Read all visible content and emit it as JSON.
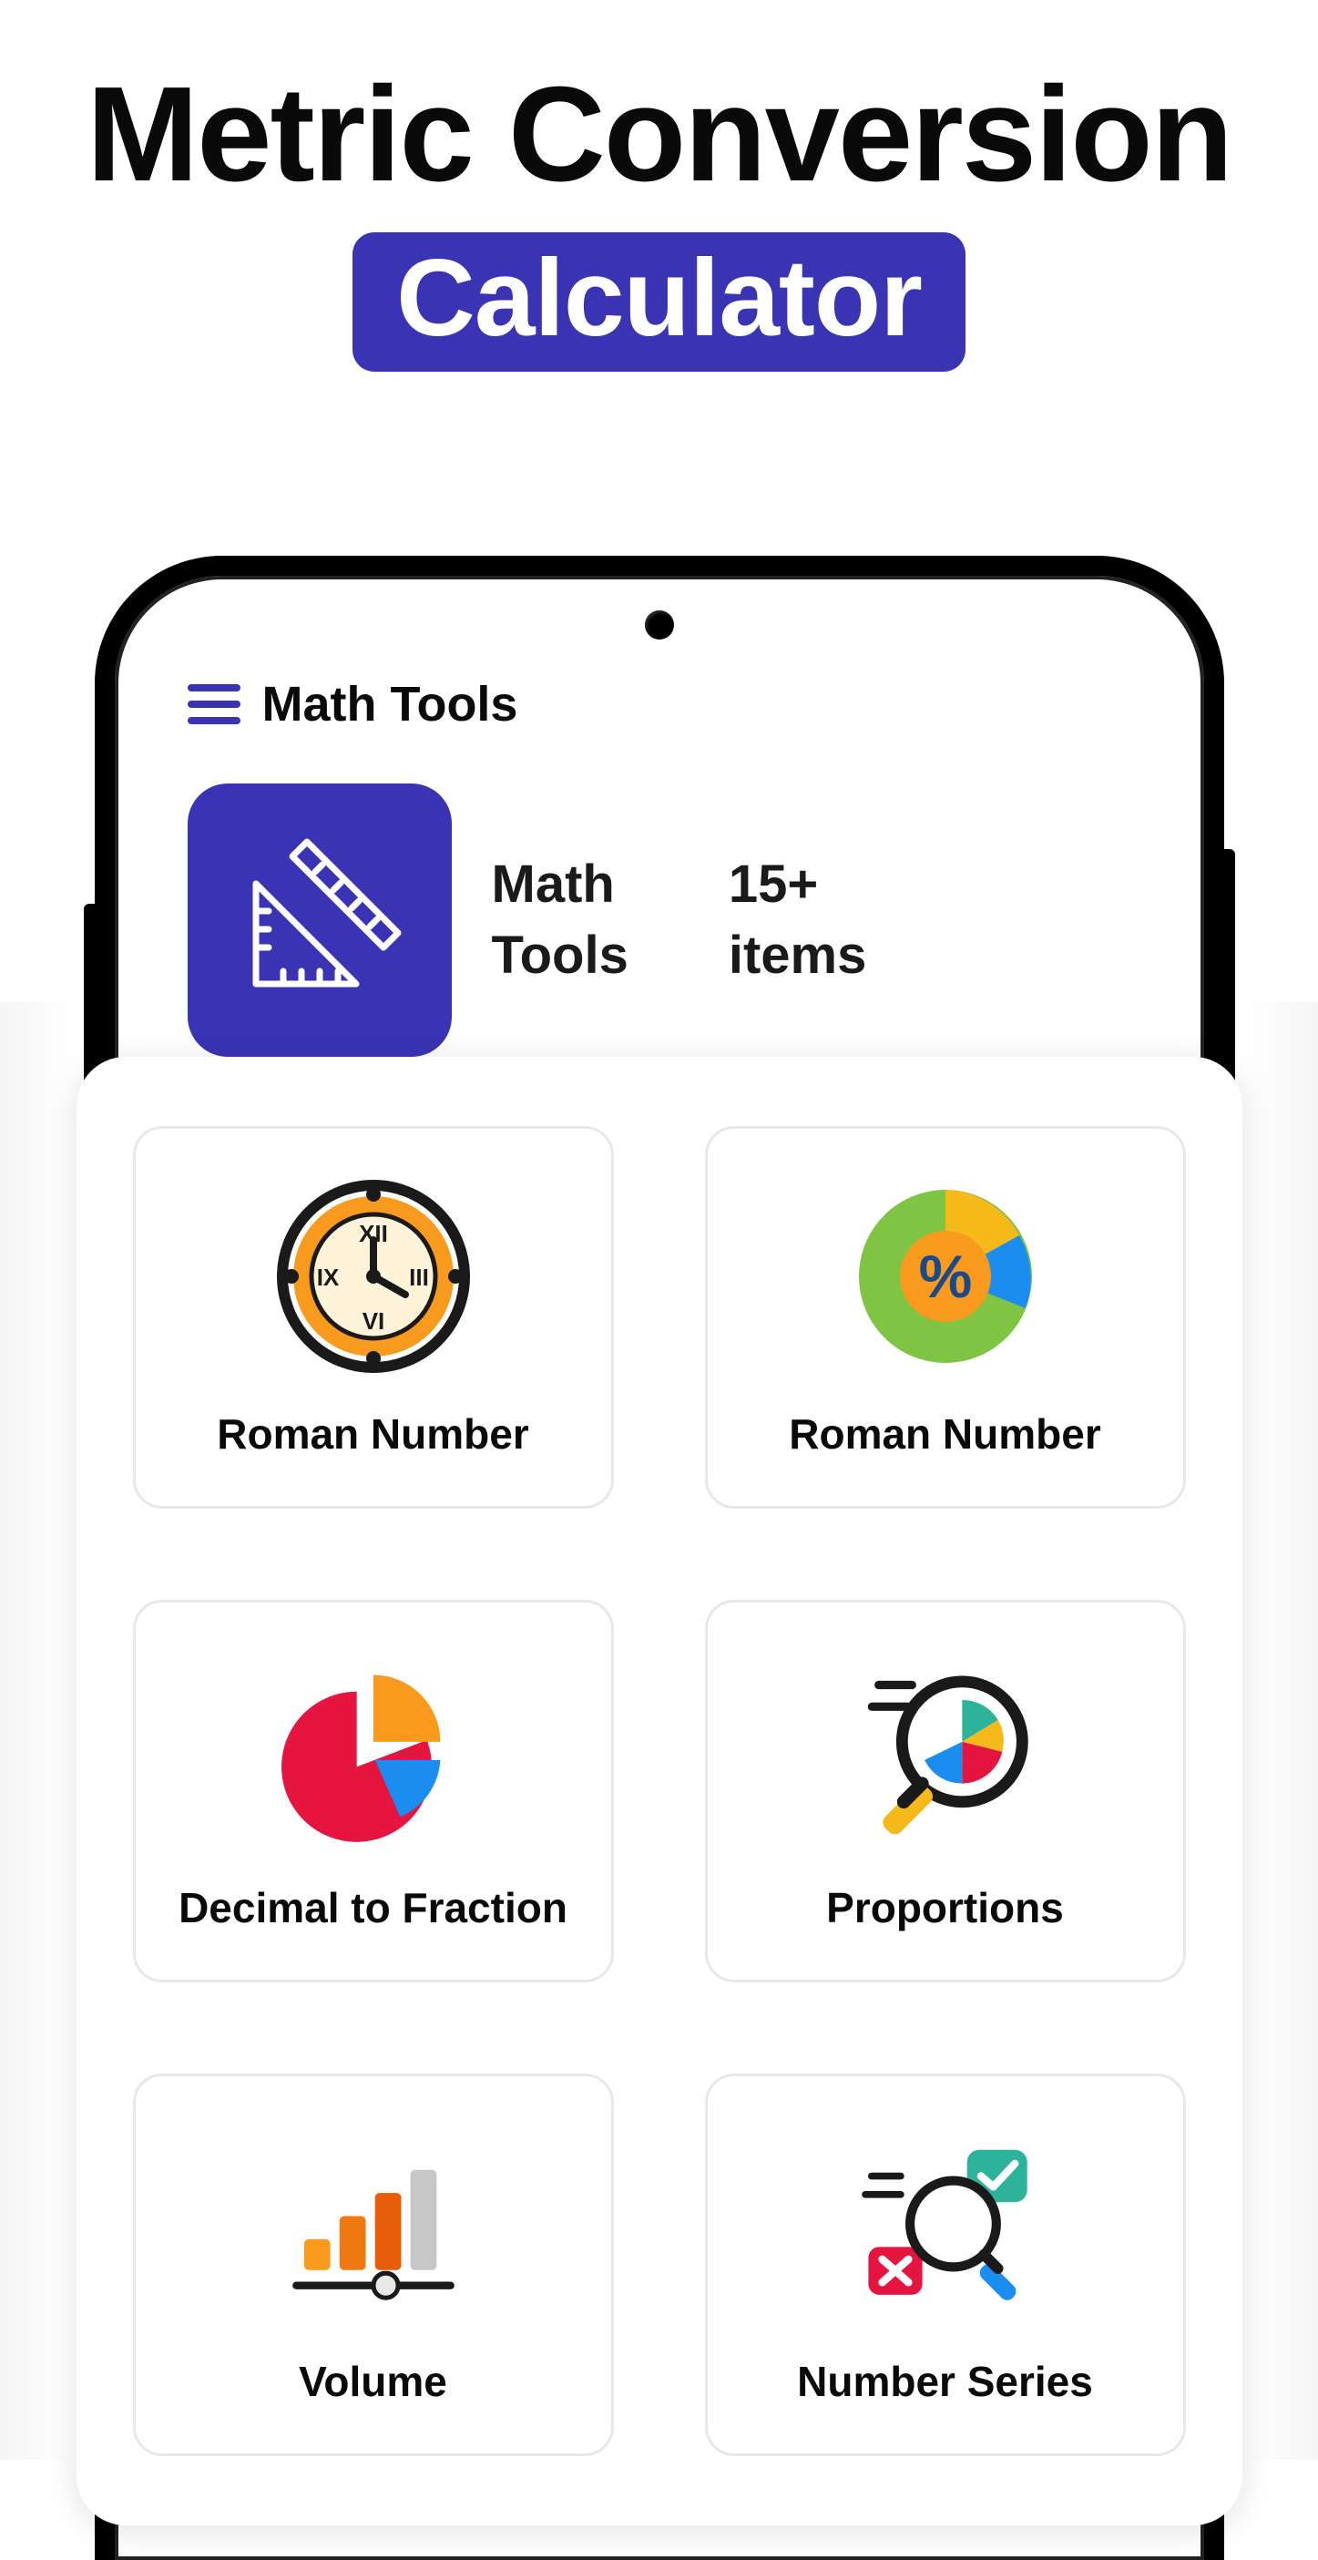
{
  "hero": {
    "title": "Metric Conversion",
    "badge": "Calculator"
  },
  "app": {
    "header_title": "Math Tools",
    "section": {
      "name_line1": "Math",
      "name_line2": "Tools",
      "count_line1": "15+",
      "count_line2": "items"
    }
  },
  "tools": [
    {
      "label": "Roman Number",
      "icon": "clock-roman-icon"
    },
    {
      "label": "Roman Number",
      "icon": "percent-pie-icon"
    },
    {
      "label": "Decimal to Fraction",
      "icon": "pie-chart-icon"
    },
    {
      "label": "Proportions",
      "icon": "magnifier-pie-icon"
    },
    {
      "label": "Volume",
      "icon": "bar-slider-icon"
    },
    {
      "label": "Number Series",
      "icon": "check-x-magnifier-icon"
    }
  ],
  "colors": {
    "accent": "#3a34b5",
    "orange": "#f89a1e",
    "red": "#e6153f",
    "blue": "#1b8cf0",
    "green": "#7fc442",
    "teal": "#2db39a",
    "grey": "#c7c7c7"
  }
}
